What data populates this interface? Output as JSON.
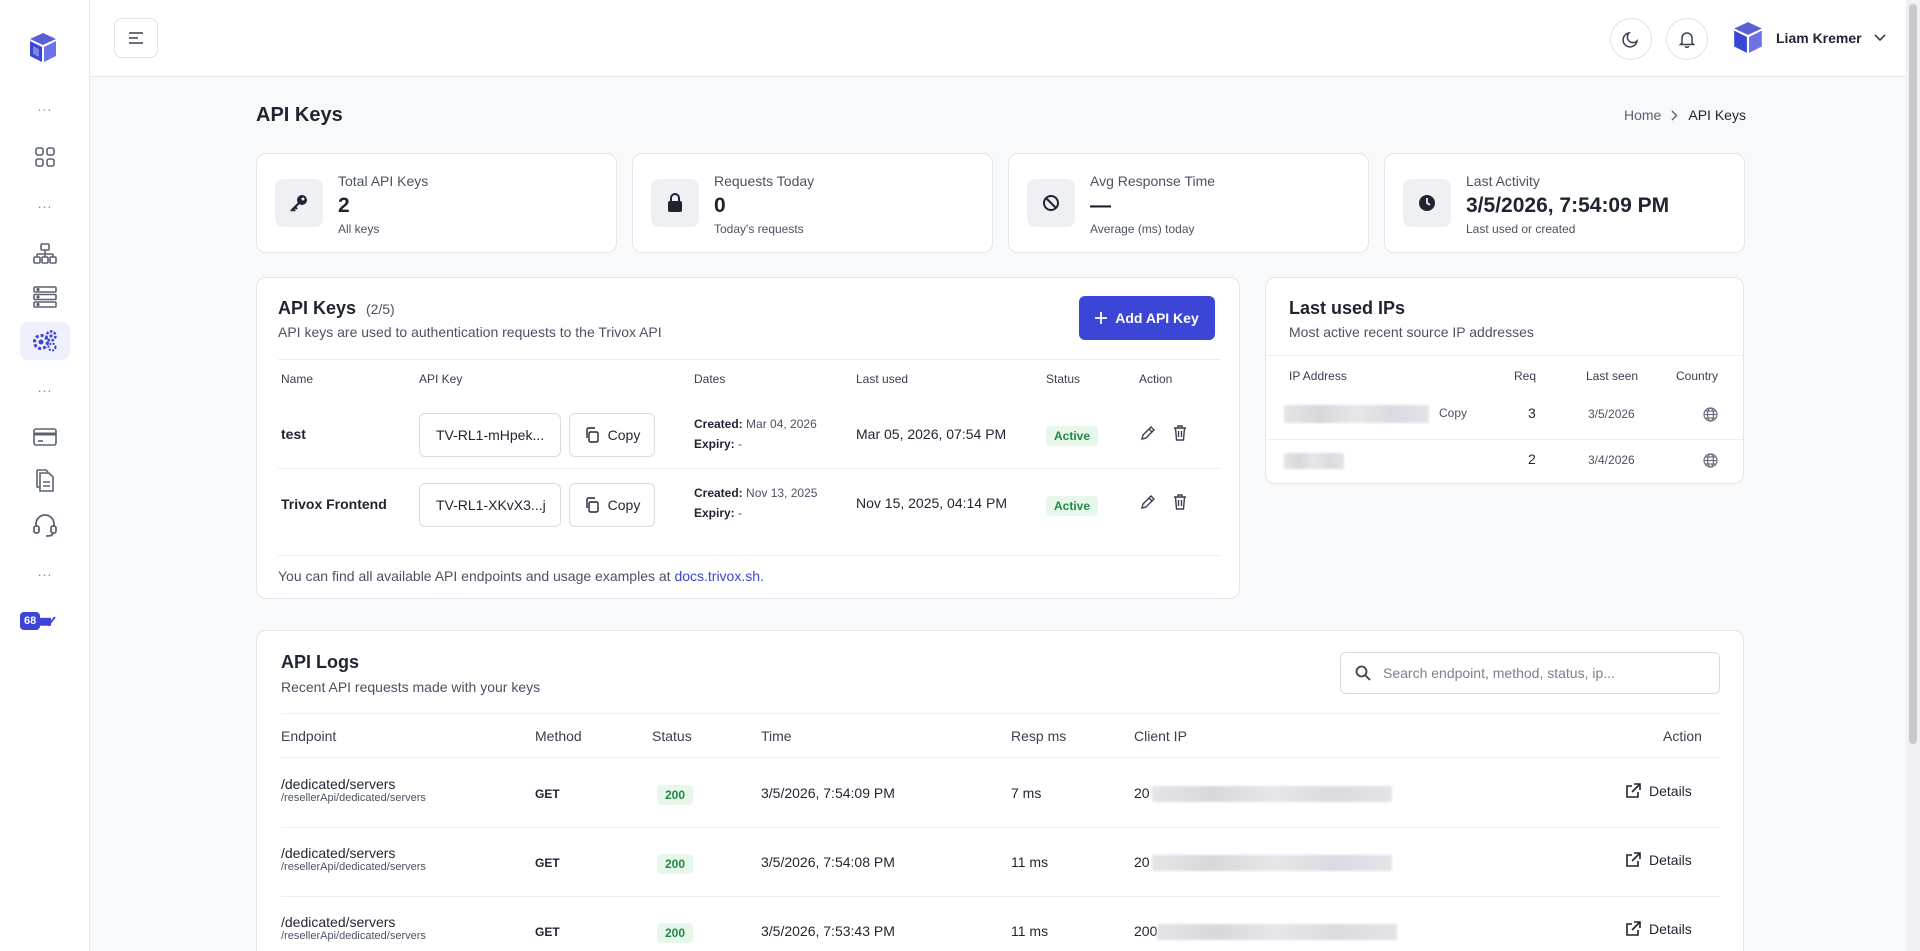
{
  "sidebar": {
    "logo_icon": "cube-logo-icon",
    "items": [
      {
        "icon": "grid-dashboard-icon"
      },
      {
        "icon": "network-icon"
      },
      {
        "icon": "servers-icon"
      },
      {
        "icon": "gears-api-icon",
        "active": true
      },
      {
        "icon": "credit-card-icon"
      },
      {
        "icon": "documents-icon"
      },
      {
        "icon": "support-headset-icon"
      }
    ],
    "badge_number": "68",
    "dots": "..."
  },
  "topbar": {
    "user_name": "Liam Kremer"
  },
  "page": {
    "title": "API Keys",
    "breadcrumb": {
      "home": "Home",
      "separator": ">",
      "current": "API Keys"
    }
  },
  "stats": [
    {
      "label": "Total API Keys",
      "value": "2",
      "sub": "All keys",
      "icon": "key-icon"
    },
    {
      "label": "Requests Today",
      "value": "0",
      "sub": "Today's requests",
      "icon": "lock-icon"
    },
    {
      "label": "Avg Response Time",
      "value": "—",
      "sub": "Average (ms) today",
      "icon": "ban-icon"
    },
    {
      "label": "Last Activity",
      "value": "3/5/2026, 7:54:09 PM",
      "sub": "Last used or created",
      "icon": "clock-icon"
    }
  ],
  "api_keys": {
    "title": "API Keys",
    "count": "(2/5)",
    "subtitle": "API keys are used to authentication requests to the Trivox API",
    "add_label": "Add API Key",
    "columns": [
      "Name",
      "API Key",
      "Dates",
      "Last used",
      "Status",
      "Action"
    ],
    "copy_label": "Copy",
    "created_label": "Created:",
    "expiry_label": "Expiry:",
    "rows": [
      {
        "name": "test",
        "key": "TV-RL1-mHpek...",
        "created": "Mar 04, 2026",
        "expiry": "-",
        "last_used": "Mar 05, 2026, 07:54 PM",
        "status": "Active"
      },
      {
        "name": "Trivox Frontend",
        "key": "TV-RL1-XKvX3...j",
        "created": "Nov 13, 2025",
        "expiry": "-",
        "last_used": "Nov 15, 2025, 04:14 PM",
        "status": "Active"
      }
    ],
    "footer_text": "You can find all available API endpoints and usage examples at",
    "footer_link": "docs.trivox.sh."
  },
  "last_ips": {
    "title": "Last used IPs",
    "subtitle": "Most active recent source IP addresses",
    "columns": [
      "IP Address",
      "Req",
      "Last seen",
      "Country"
    ],
    "copy_label": "Copy",
    "rows": [
      {
        "req": "3",
        "last_seen": "3/5/2026"
      },
      {
        "req": "2",
        "last_seen": "3/4/2026"
      }
    ]
  },
  "logs": {
    "title": "API Logs",
    "subtitle": "Recent API requests made with your keys",
    "search_placeholder": "Search endpoint, method, status, ip...",
    "columns": [
      "Endpoint",
      "Method",
      "Status",
      "Time",
      "Resp ms",
      "Client IP",
      "Action"
    ],
    "details_label": "Details",
    "rows": [
      {
        "endpoint": "/dedicated/servers",
        "path": "/resellerApi/dedicated/servers",
        "method": "GET",
        "status": "200",
        "time": "3/5/2026, 7:54:09 PM",
        "resp": "7 ms",
        "ip_prefix": "20"
      },
      {
        "endpoint": "/dedicated/servers",
        "path": "/resellerApi/dedicated/servers",
        "method": "GET",
        "status": "200",
        "time": "3/5/2026, 7:54:08 PM",
        "resp": "11 ms",
        "ip_prefix": "20"
      },
      {
        "endpoint": "/dedicated/servers",
        "path": "/resellerApi/dedicated/servers",
        "method": "GET",
        "status": "200",
        "time": "3/5/2026, 7:53:43 PM",
        "resp": "11 ms",
        "ip_prefix": "200"
      }
    ]
  }
}
